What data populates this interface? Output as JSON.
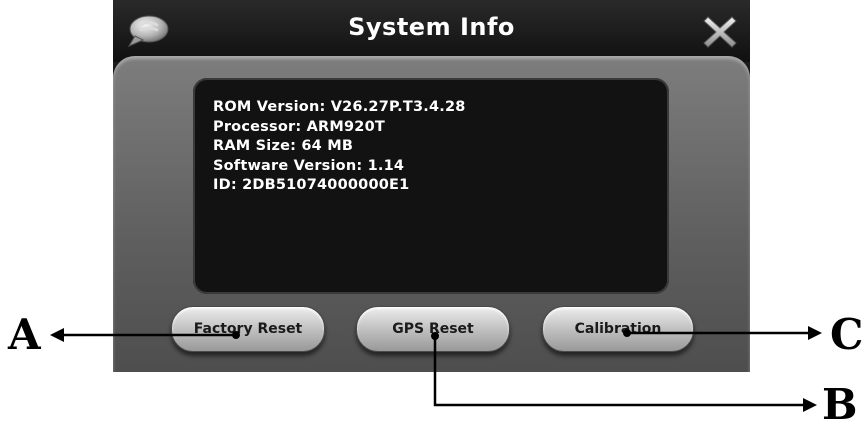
{
  "window": {
    "title": "System Info",
    "chat_icon": "speech-bubble-icon",
    "close_icon": "close-x-icon"
  },
  "info": {
    "lines": [
      "ROM Version: V26.27P.T3.4.28",
      "Processor: ARM920T",
      "RAM Size: 64 MB",
      "Software Version: 1.14",
      "ID: 2DB51074000000E1"
    ]
  },
  "buttons": {
    "factory_reset": "Factory Reset",
    "gps_reset": "GPS Reset",
    "calibration": "Calibration"
  },
  "annotations": {
    "a": "A",
    "b": "B",
    "c": "C"
  }
}
